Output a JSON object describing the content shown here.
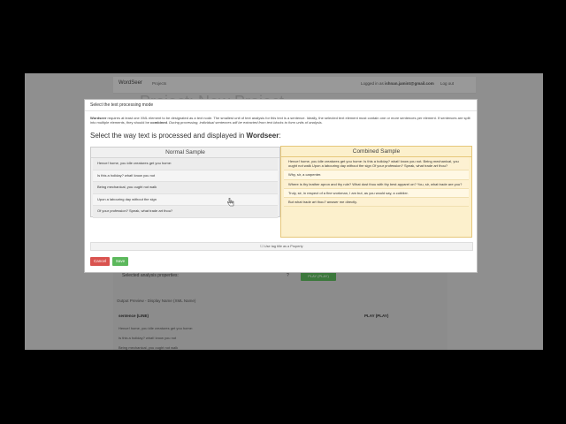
{
  "background_page": {
    "brand": "WordSeer",
    "nav_projects": "Projects",
    "user_text": "Logged in as",
    "user_email": "ishnan.jamint@gmail.com",
    "logout": "Log out",
    "heading": "Project: New Project",
    "properties_label": "Selected analysis properties:",
    "help_icon": "?",
    "property_button": "PLAY (PLAY)",
    "preview_title": "Output Preview - Display Name (XML Name)",
    "preview_col1": "sentence (LINE)",
    "preview_col2": "PLAY (PLAY)",
    "preview_rows": [
      "Hence! home, you idle creatures get you home:",
      "Is this a holiday? what! know you not",
      "Being mechanical, you ought not walk"
    ]
  },
  "modal": {
    "title": "Select the text processing mode",
    "intro_bold": "Wordseer",
    "intro_rest": " requires at least one XML element to be designated as a text node. The smallest unit of text analysis for this text is a sentence. Ideally, the selected text element must contain one or more sentences per element. If sentences are split into multiple elements, they should be ",
    "intro_bold2": "combined",
    "intro_tail": ". During processing, individual sentences will be extracted from text blocks to form units of analysis.",
    "prompt_start": "Select the way text is processed and displayed in ",
    "prompt_bold": "Wordseer",
    "prompt_end": ":",
    "normal_title": "Normal Sample",
    "normal_rows": [
      "Hence! home, you idle creatures get you home:",
      "Is this a holiday? what! know you not",
      "Being mechanical, you ought not walk",
      "Upon a labouring day without the sign",
      "Of your profession? Speak, what trade art thou?"
    ],
    "combined_title": "Combined Sample",
    "combined_rows": [
      "Hence! home, you idle creatures get you home: Is this a holiday? what! know you not. Being mechanical, you ought not walk Upon a labouring day without the sign Of your profession? Speak, what trade art thou?",
      "Why, sir, a carpenter.",
      "Where is thy leather apron and thy rule? What dost thou with thy best apparel on? You, sir, what trade are you?",
      "Truly, sir, in respect of a fine workman, I am but, as you would say, a cobbler.",
      "But what trade art thou? answer me directly."
    ],
    "tag_option": "Use tag title as a Property",
    "cancel_label": "Cancel",
    "save_label": "Save"
  }
}
